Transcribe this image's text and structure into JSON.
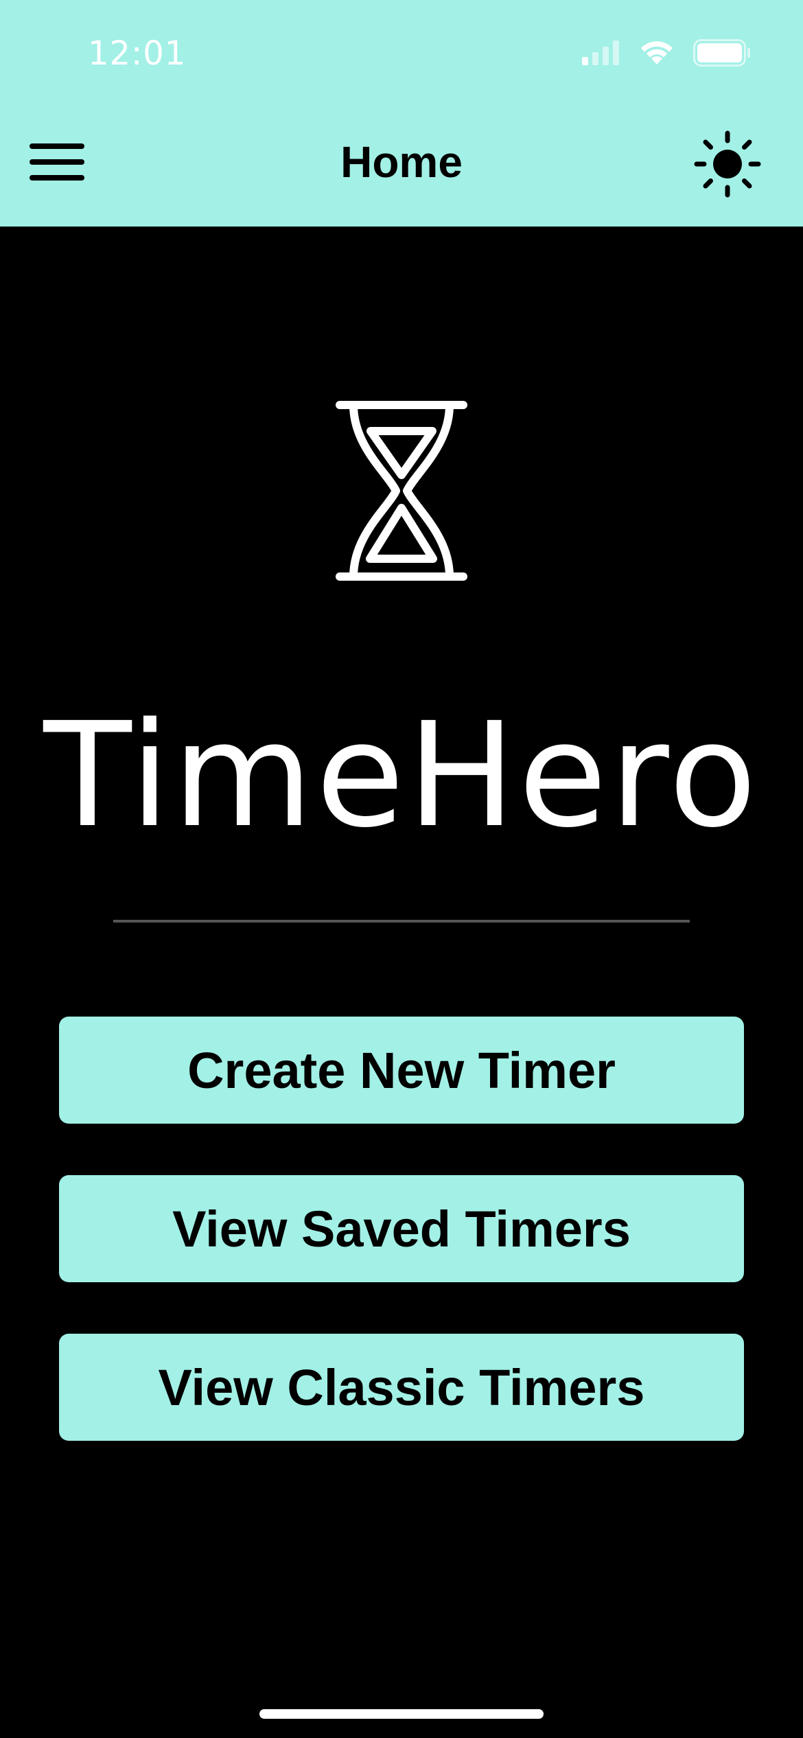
{
  "status_bar": {
    "time": "12:01",
    "icons": [
      "cellular-signal-icon",
      "wifi-icon",
      "battery-icon"
    ]
  },
  "header": {
    "title": "Home",
    "menu_icon": "hamburger-menu-icon",
    "theme_icon": "sun-icon"
  },
  "branding": {
    "logo_icon": "hourglass-icon",
    "app_name": "TimeHero"
  },
  "actions": {
    "create_label": "Create New Timer",
    "saved_label": "View Saved Timers",
    "classic_label": "View Classic Timers"
  },
  "colors": {
    "accent": "#a2f0e6",
    "background": "#000000",
    "text_on_accent": "#000000",
    "text_on_dark": "#ffffff",
    "divider": "#555555"
  }
}
